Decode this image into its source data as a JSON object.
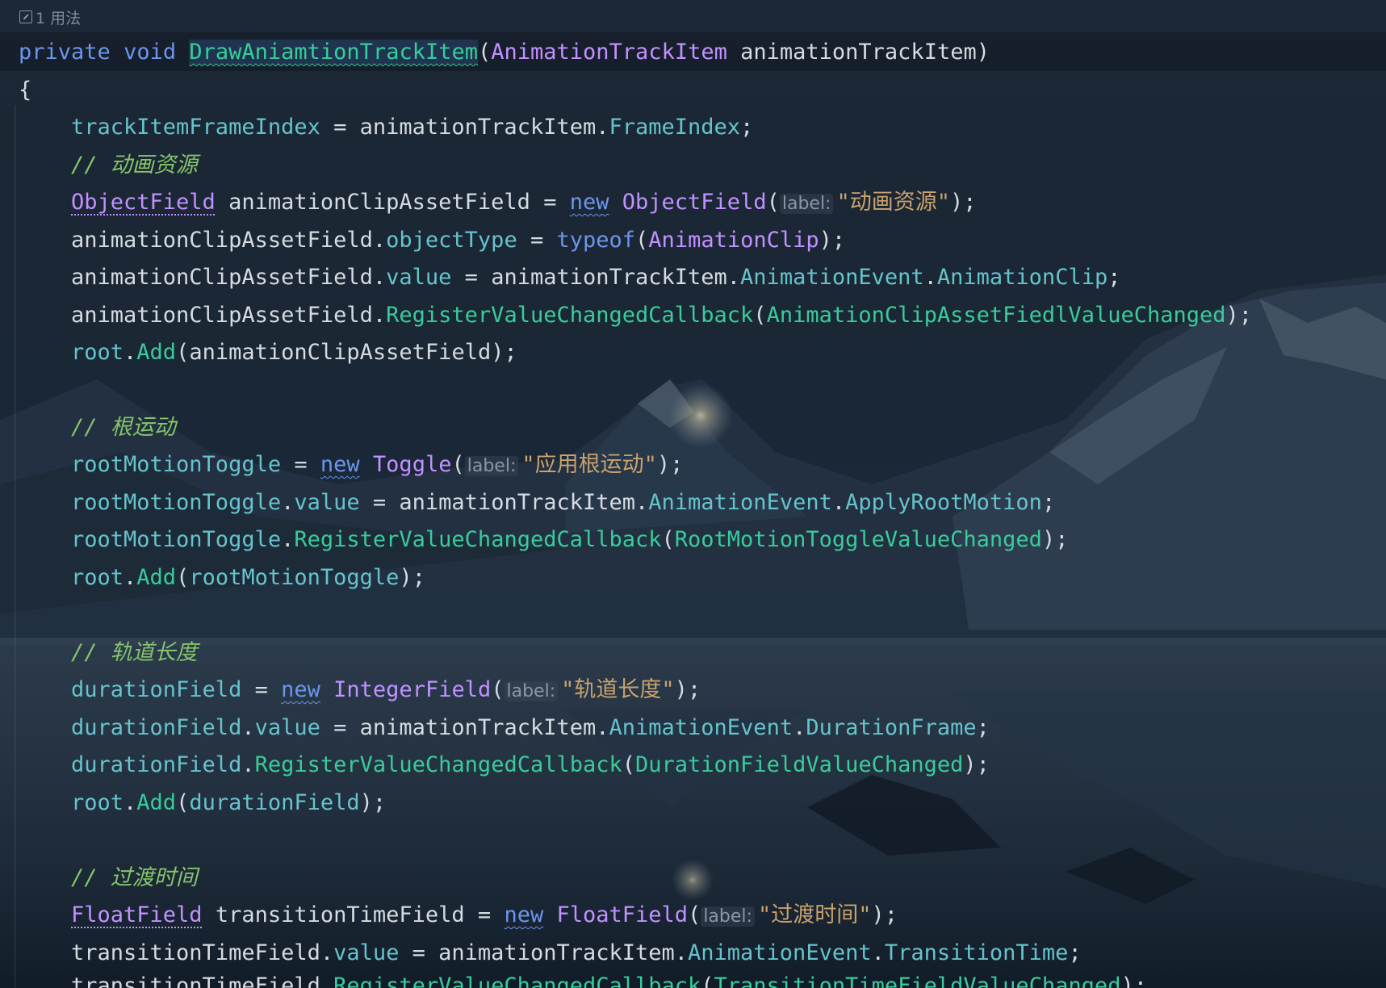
{
  "usage": {
    "icon": "external-link-icon",
    "text": "1 用法"
  },
  "code": {
    "sig": {
      "kw_private": "private",
      "kw_void": "void",
      "method": "DrawAniamtionTrackItem",
      "open": "(",
      "param_type": "AnimationTrackItem",
      "param_name": " animationTrackItem",
      "close": ")"
    },
    "brace_open": "{",
    "l1": {
      "a": "trackItemFrameIndex",
      "b": " = animationTrackItem.",
      "c": "FrameIndex",
      "d": ";"
    },
    "c1": "// 动画资源",
    "l2": {
      "type": "ObjectField",
      "var": " animationClipAssetField = ",
      "kw_new": "new",
      "sp": " ",
      "ctor": "ObjectField",
      "open": "(",
      "hint": "label:",
      "str": "\"动画资源\"",
      "close": ");"
    },
    "l3": {
      "a": "animationClipAssetField.",
      "b": "objectType",
      "c": " = ",
      "d": "typeof",
      "e": "(",
      "f": "AnimationClip",
      "g": ");"
    },
    "l4": {
      "a": "animationClipAssetField.",
      "b": "value",
      "c": " = animationTrackItem.",
      "d": "AnimationEvent",
      "e": ".",
      "f": "AnimationClip",
      "g": ";"
    },
    "l5": {
      "a": "animationClipAssetField.",
      "b": "RegisterValueChangedCallback",
      "c": "(",
      "d": "AnimationClipAssetFiedlValueChanged",
      "e": ");"
    },
    "l6": {
      "a": "root",
      "b": ".",
      "c": "Add",
      "d": "(animationClipAssetField);"
    },
    "c2": "// 根运动",
    "l7": {
      "a": "rootMotionToggle",
      "b": " = ",
      "kw_new": "new",
      "sp": " ",
      "ctor": "Toggle",
      "open": "(",
      "hint": "label:",
      "str": "\"应用根运动\"",
      "close": ");"
    },
    "l8": {
      "a": "rootMotionToggle",
      "b": ".",
      "c": "value",
      "d": " = animationTrackItem.",
      "e": "AnimationEvent",
      "f": ".",
      "g": "ApplyRootMotion",
      "h": ";"
    },
    "l9": {
      "a": "rootMotionToggle",
      "b": ".",
      "c": "RegisterValueChangedCallback",
      "d": "(",
      "e": "RootMotionToggleValueChanged",
      "f": ");"
    },
    "l10": {
      "a": "root",
      "b": ".",
      "c": "Add",
      "d": "(",
      "e": "rootMotionToggle",
      "f": ");"
    },
    "c3": "// 轨道长度",
    "l11": {
      "a": "durationField",
      "b": " = ",
      "kw_new": "new",
      "sp": " ",
      "ctor": "IntegerField",
      "open": "(",
      "hint": "label:",
      "str": "\"轨道长度\"",
      "close": ");"
    },
    "l12": {
      "a": "durationField",
      "b": ".",
      "c": "value",
      "d": " = animationTrackItem.",
      "e": "AnimationEvent",
      "f": ".",
      "g": "DurationFrame",
      "h": ";"
    },
    "l13": {
      "a": "durationField",
      "b": ".",
      "c": "RegisterValueChangedCallback",
      "d": "(",
      "e": "DurationFieldValueChanged",
      "f": ");"
    },
    "l14": {
      "a": "root",
      "b": ".",
      "c": "Add",
      "d": "(",
      "e": "durationField",
      "f": ");"
    },
    "c4": "// 过渡时间",
    "l15": {
      "type": "FloatField",
      "var": " transitionTimeField = ",
      "kw_new": "new",
      "sp": " ",
      "ctor": "FloatField",
      "open": "(",
      "hint": "label:",
      "str": "\"过渡时间\"",
      "close": ");"
    },
    "l16": {
      "a": "transitionTimeField.",
      "b": "value",
      "c": " = animationTrackItem.",
      "d": "AnimationEvent",
      "e": ".",
      "f": "TransitionTime",
      "g": ";"
    },
    "l17": {
      "a": "transitionTimeField.",
      "b": "RegisterValueChangedCallback",
      "c": "(",
      "d": "TransitionTimeFieldValueChanged",
      "e": ");"
    }
  }
}
